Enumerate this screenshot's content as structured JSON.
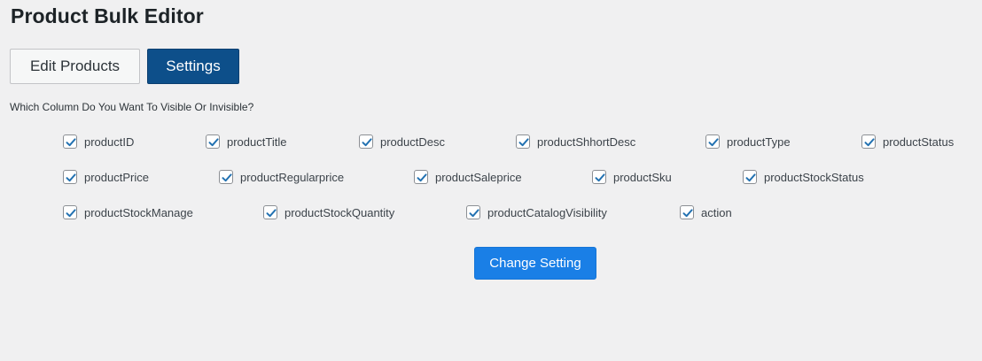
{
  "page": {
    "title": "Product Bulk Editor"
  },
  "tabs": [
    {
      "label": "Edit Products",
      "active": false
    },
    {
      "label": "Settings",
      "active": true
    }
  ],
  "settings": {
    "question": "Which Column Do You Want To Visible Or Invisible?",
    "columns": [
      {
        "label": "productID",
        "checked": true
      },
      {
        "label": "productTitle",
        "checked": true
      },
      {
        "label": "productDesc",
        "checked": true
      },
      {
        "label": "productShhortDesc",
        "checked": true
      },
      {
        "label": "productType",
        "checked": true
      },
      {
        "label": "productStatus",
        "checked": true
      },
      {
        "label": "productPrice",
        "checked": true
      },
      {
        "label": "productRegularprice",
        "checked": true
      },
      {
        "label": "productSaleprice",
        "checked": true
      },
      {
        "label": "productSku",
        "checked": true
      },
      {
        "label": "productStockStatus",
        "checked": true
      },
      {
        "label": "productStockManage",
        "checked": true
      },
      {
        "label": "productStockQuantity",
        "checked": true
      },
      {
        "label": "productCatalogVisibility",
        "checked": true
      },
      {
        "label": "action",
        "checked": true
      }
    ],
    "submit_label": "Change Setting"
  },
  "colors": {
    "accent": "#1a7fe6",
    "active_tab": "#0d4f8a",
    "checkmark": "#2271b1",
    "background": "#f0f0f1"
  },
  "icons": {
    "checkbox": "checkmark-icon"
  }
}
